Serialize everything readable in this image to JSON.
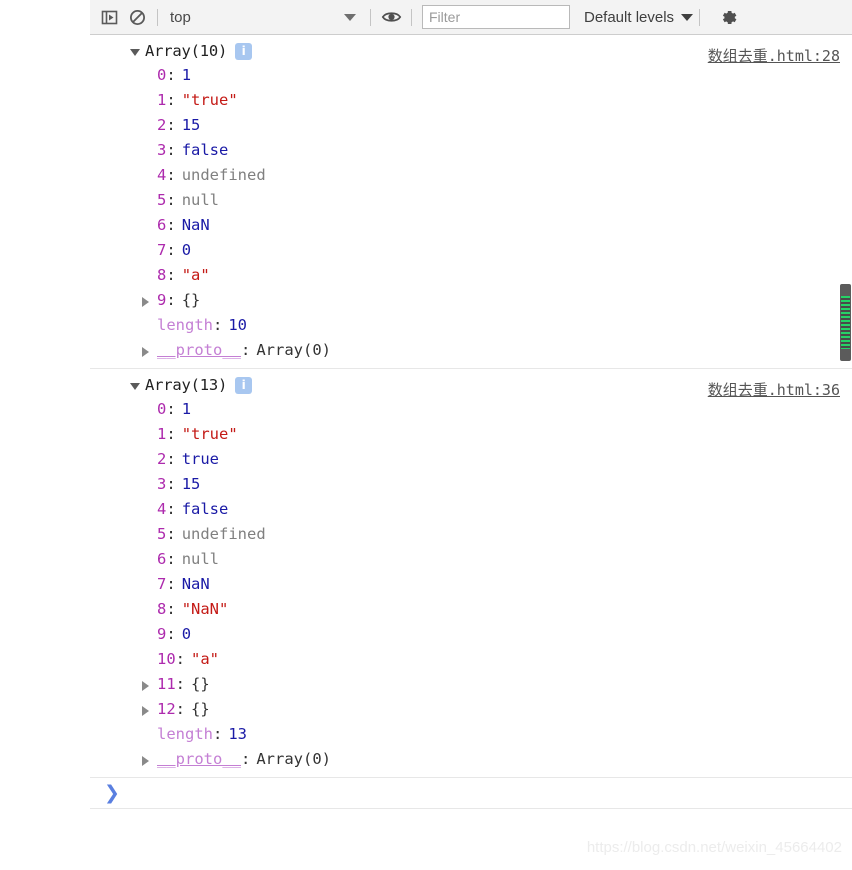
{
  "toolbar": {
    "panel_icon": "sidebar-toggle-icon",
    "clear_icon": "clear-console-icon",
    "context_value": "top",
    "eye_icon": "eye-icon",
    "filter_placeholder": "Filter",
    "filter_value": "",
    "levels_label": "Default levels",
    "gear_icon": "gear-icon"
  },
  "console": {
    "messages": [
      {
        "title": "Array(10)",
        "badge": "i",
        "source": "数组去重.html:28",
        "props": [
          {
            "key": "0",
            "value": "1",
            "type": "number",
            "expandable": false
          },
          {
            "key": "1",
            "value": "\"true\"",
            "type": "string",
            "expandable": false
          },
          {
            "key": "2",
            "value": "15",
            "type": "number",
            "expandable": false
          },
          {
            "key": "3",
            "value": "false",
            "type": "bool",
            "expandable": false
          },
          {
            "key": "4",
            "value": "undefined",
            "type": "null",
            "expandable": false
          },
          {
            "key": "5",
            "value": "null",
            "type": "null",
            "expandable": false
          },
          {
            "key": "6",
            "value": "NaN",
            "type": "number",
            "expandable": false
          },
          {
            "key": "7",
            "value": "0",
            "type": "number",
            "expandable": false
          },
          {
            "key": "8",
            "value": "\"a\"",
            "type": "string",
            "expandable": false
          },
          {
            "key": "9",
            "value": "{}",
            "type": "object",
            "expandable": true
          },
          {
            "key": "length",
            "value": "10",
            "type": "number",
            "expandable": false,
            "dim": true
          },
          {
            "key": "__proto__",
            "value": "Array(0)",
            "type": "proto",
            "expandable": true,
            "dim": true
          }
        ]
      },
      {
        "title": "Array(13)",
        "badge": "i",
        "source": "数组去重.html:36",
        "props": [
          {
            "key": "0",
            "value": "1",
            "type": "number",
            "expandable": false
          },
          {
            "key": "1",
            "value": "\"true\"",
            "type": "string",
            "expandable": false
          },
          {
            "key": "2",
            "value": "true",
            "type": "bool",
            "expandable": false
          },
          {
            "key": "3",
            "value": "15",
            "type": "number",
            "expandable": false
          },
          {
            "key": "4",
            "value": "false",
            "type": "bool",
            "expandable": false
          },
          {
            "key": "5",
            "value": "undefined",
            "type": "null",
            "expandable": false
          },
          {
            "key": "6",
            "value": "null",
            "type": "null",
            "expandable": false
          },
          {
            "key": "7",
            "value": "NaN",
            "type": "number",
            "expandable": false
          },
          {
            "key": "8",
            "value": "\"NaN\"",
            "type": "string",
            "expandable": false
          },
          {
            "key": "9",
            "value": "0",
            "type": "number",
            "expandable": false
          },
          {
            "key": "10",
            "value": "\"a\"",
            "type": "string",
            "expandable": false
          },
          {
            "key": "11",
            "value": "{}",
            "type": "object",
            "expandable": true
          },
          {
            "key": "12",
            "value": "{}",
            "type": "object",
            "expandable": true
          },
          {
            "key": "length",
            "value": "13",
            "type": "number",
            "expandable": false,
            "dim": true
          },
          {
            "key": "__proto__",
            "value": "Array(0)",
            "type": "proto",
            "expandable": true,
            "dim": true
          }
        ]
      }
    ],
    "prompt_symbol": "❯"
  },
  "watermark": "https://blog.csdn.net/weixin_45664402",
  "colors": {
    "key": "#ad2aad",
    "key_dim": "#c47fd4",
    "number": "#1a1aa6",
    "string": "#c41a16",
    "nullish": "#808080",
    "badge_bg": "#a8c7f0",
    "scroll_accent": "#25d366",
    "prompt": "#5a7fe0"
  }
}
